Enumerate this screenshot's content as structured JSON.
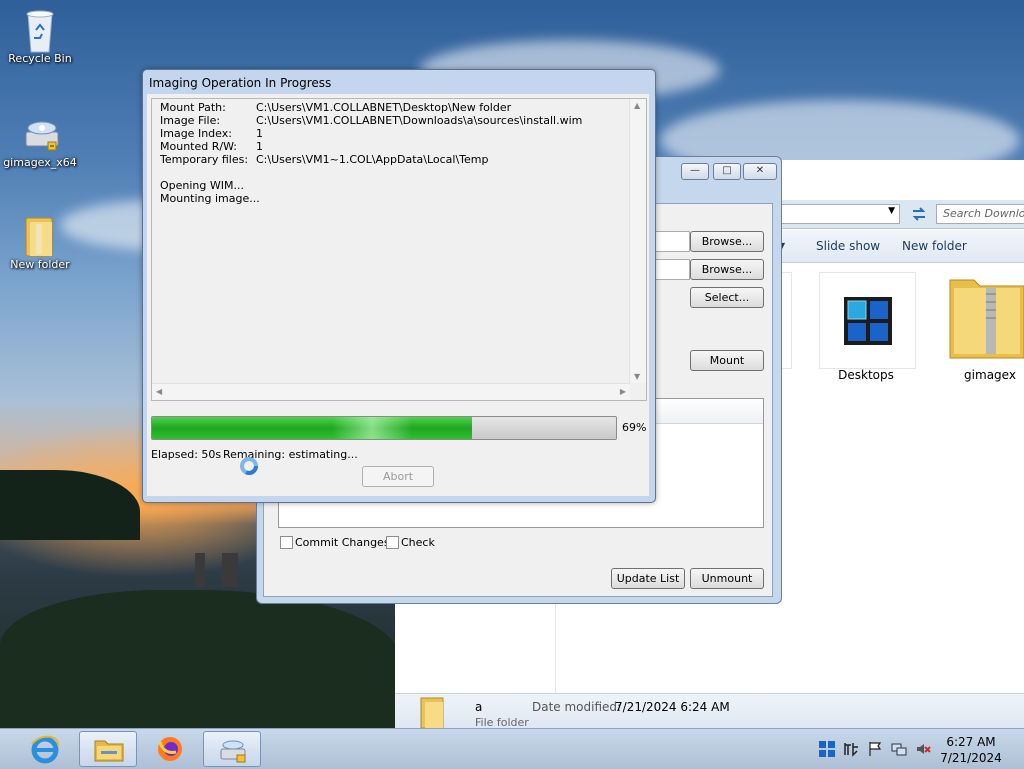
{
  "desktop": {
    "icons": [
      {
        "label": "Recycle Bin"
      },
      {
        "label": "gimagex_x64"
      },
      {
        "label": "New folder"
      }
    ]
  },
  "explorer": {
    "search_placeholder": "Search Downlo",
    "toolbar": {
      "slideshow": "Slide show",
      "new_folder": "New folder"
    },
    "items": [
      {
        "label": "Desktops"
      },
      {
        "label": "gimagex"
      }
    ],
    "details": {
      "name": "a",
      "date_label": "Date modified:",
      "date_value": "7/21/2024 6:24 AM",
      "type": "File folder"
    }
  },
  "gimagex": {
    "browse1": "Browse...",
    "browse2": "Browse...",
    "select": "Select...",
    "mount": "Mount",
    "commit_label": "Commit Changes",
    "check_label": "Check",
    "update_list": "Update List",
    "unmount": "Unmount",
    "caption_minimize": "—",
    "caption_maximize": "□",
    "caption_close": "✕"
  },
  "progress": {
    "title": "Imaging Operation In Progress",
    "log": [
      {
        "key": "Mount Path:",
        "value": "C:\\Users\\VM1.COLLABNET\\Desktop\\New folder"
      },
      {
        "key": "Image File:",
        "value": "C:\\Users\\VM1.COLLABNET\\Downloads\\a\\sources\\install.wim"
      },
      {
        "key": "Image Index:",
        "value": "1"
      },
      {
        "key": "Mounted R/W:",
        "value": "1"
      },
      {
        "key": "Temporary files:",
        "value": "C:\\Users\\VM1~1.COL\\AppData\\Local\\Temp"
      }
    ],
    "messages": [
      "Opening WIM...",
      "Mounting image..."
    ],
    "percent_value": 69,
    "percent_text": "69%",
    "elapsed": "Elapsed: 50s",
    "remaining": "Remaining: estimating...",
    "abort": "Abort"
  },
  "taskbar": {
    "clock_time": "6:27 AM",
    "clock_date": "7/21/2024",
    "apps": [
      "ie-icon",
      "explorer-icon",
      "firefox-icon",
      "gimagex-icon"
    ],
    "colors": {
      "progress_green": "#28b428",
      "accent": "#c3d6ee"
    }
  }
}
